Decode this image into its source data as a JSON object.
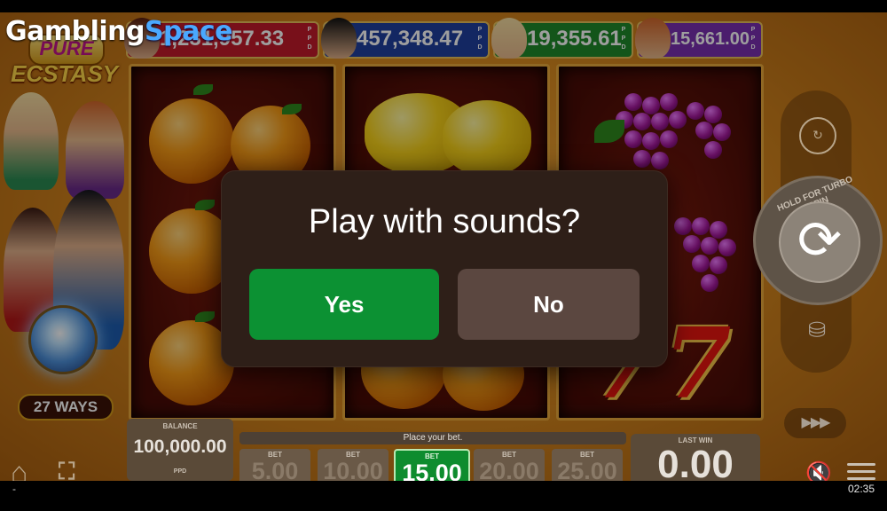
{
  "watermark": {
    "part1": "Gambling",
    "part2": "Space"
  },
  "game": {
    "logo_top": "PURE",
    "logo_bottom": "ECSTASY",
    "ways": "27 WAYS"
  },
  "jackpots": [
    {
      "value": "1,231,957.33",
      "ppd": "P P D",
      "color": "#c21b2a"
    },
    {
      "value": "457,348.47",
      "ppd": "P P D",
      "color": "#1f3f9e"
    },
    {
      "value": "19,355.61",
      "ppd": "P P D",
      "color": "#1f8a2a"
    },
    {
      "value": "15,661.00",
      "ppd": "P P D",
      "color": "#7a2fb0"
    }
  ],
  "dialog": {
    "question": "Play with sounds?",
    "yes_label": "Yes",
    "no_label": "No"
  },
  "controls": {
    "turbo_hint": "HOLD FOR TURBO SPIN",
    "balance_label": "BALANCE",
    "balance_value": "100,000.00",
    "currency": "PPD",
    "bet_prompt": "Place your bet.",
    "bet_label": "BET",
    "bets": [
      "5.00",
      "10.00",
      "15.00",
      "20.00",
      "25.00"
    ],
    "active_bet": "15.00",
    "last_win_label": "LAST WIN",
    "last_win_value": "0.00"
  },
  "status": {
    "left": "-",
    "time": "02:35"
  },
  "icons": [
    "home-icon",
    "fullscreen-icon",
    "replay-icon",
    "spin-icon",
    "coins-icon",
    "fast-forward-icon",
    "mute-icon",
    "menu-icon"
  ]
}
